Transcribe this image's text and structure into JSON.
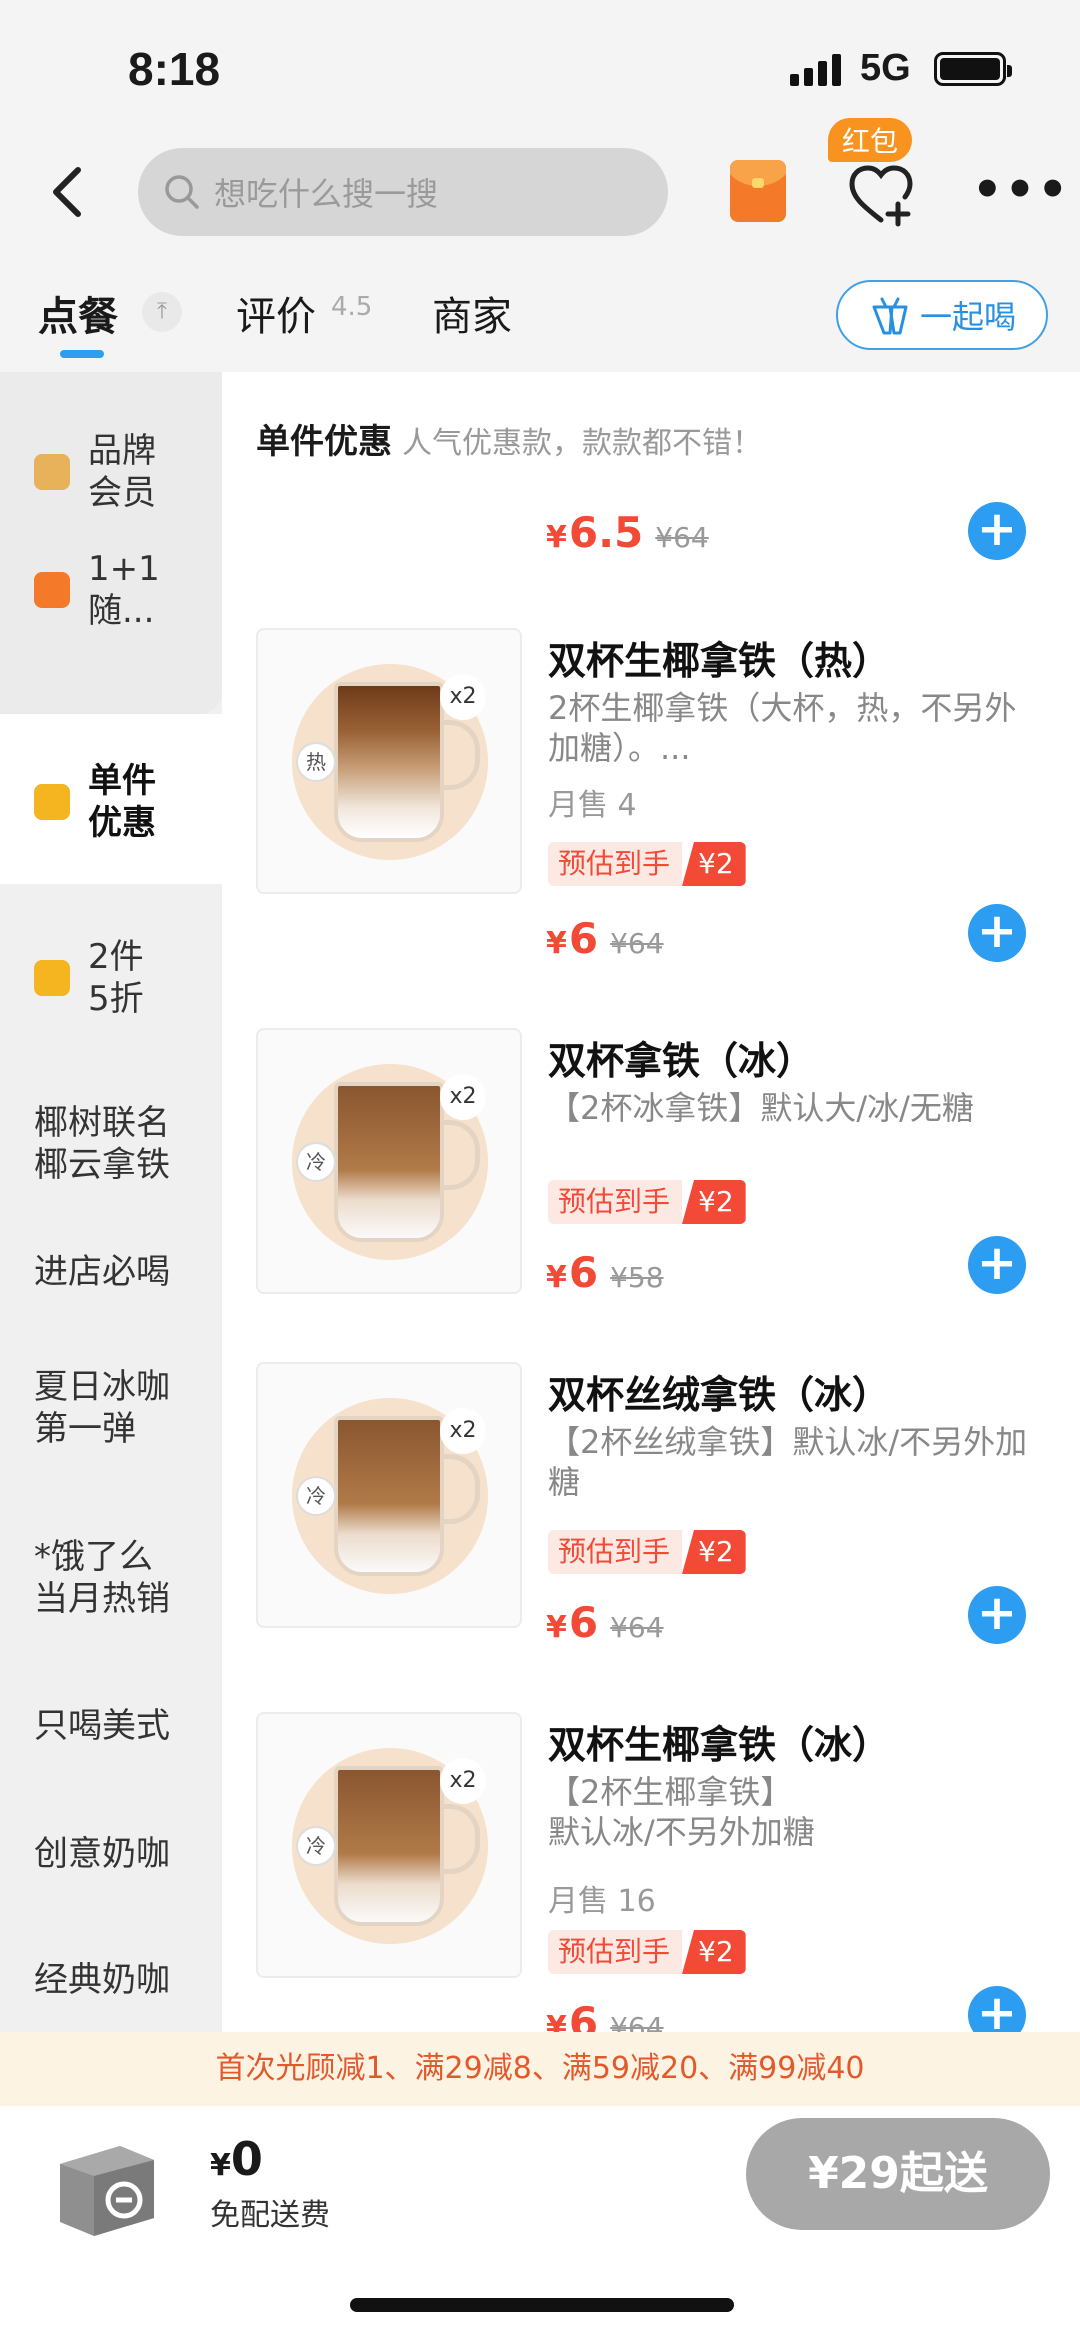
{
  "status_bar": {
    "time": "8:18",
    "network": "5G"
  },
  "header": {
    "search_placeholder": "想吃什么搜一搜",
    "redpacket_badge": "红包",
    "icons": [
      "back-icon",
      "search-icon",
      "red-envelope-icon",
      "favorite-icon",
      "more-icon"
    ]
  },
  "tabs": {
    "order": "点餐",
    "reviews": "评价",
    "rating": "4.5",
    "merchant": "商家",
    "drink_together": "一起喝"
  },
  "sidebar": {
    "items": [
      {
        "label": "品牌\n会员"
      },
      {
        "label": "1+1\n随..."
      },
      {
        "label": "单件\n优惠"
      },
      {
        "label": "2件\n5折"
      },
      {
        "label": "椰树联名\n椰云拿铁"
      },
      {
        "label": "进店必喝"
      },
      {
        "label": "夏日冰咖\n第一弹"
      },
      {
        "label": "*饿了么\n当月热销"
      },
      {
        "label": "只喝美式"
      },
      {
        "label": "创意奶咖"
      },
      {
        "label": "经典奶咖"
      }
    ]
  },
  "section": {
    "title": "单件优惠",
    "subtitle": "人气优惠款，款款都不错！",
    "first_price": {
      "currency": "¥",
      "value": "6.5",
      "original": "¥64"
    }
  },
  "products": [
    {
      "name": "双杯生椰拿铁（热）",
      "desc": "2杯生椰拿铁（大杯，热，不另外加糖）。...",
      "sales": "月售 4",
      "tag_label": "预估到手",
      "tag_value": "¥2",
      "currency": "¥",
      "price": "6",
      "original": "¥64",
      "temp": "热",
      "qty": "x2"
    },
    {
      "name": "双杯拿铁（冰）",
      "desc": "【2杯冰拿铁】默认大/冰/无糖",
      "sales": "",
      "tag_label": "预估到手",
      "tag_value": "¥2",
      "currency": "¥",
      "price": "6",
      "original": "¥58",
      "temp": "冷",
      "qty": "x2"
    },
    {
      "name": "双杯丝绒拿铁（冰）",
      "desc": "【2杯丝绒拿铁】默认冰/不另外加糖",
      "sales": "",
      "tag_label": "预估到手",
      "tag_value": "¥2",
      "currency": "¥",
      "price": "6",
      "original": "¥64",
      "temp": "冷",
      "qty": "x2"
    },
    {
      "name": "双杯生椰拿铁（冰）",
      "desc": "【2杯生椰拿铁】\n默认冰/不另外加糖",
      "sales": "月售 16",
      "tag_label": "预估到手",
      "tag_value": "¥2",
      "currency": "¥",
      "price": "6",
      "original": "¥64",
      "temp": "冷",
      "qty": "x2"
    }
  ],
  "promo_bar": "首次光顾减1、满29减8、满59减20、满99减40",
  "cart_bar": {
    "currency": "¥",
    "total": "0",
    "delivery": "免配送费",
    "min_order": "¥29起送"
  },
  "colors": {
    "accent": "#2c9df0",
    "price": "#f24a36",
    "promo_bg": "#fcf3e3"
  }
}
